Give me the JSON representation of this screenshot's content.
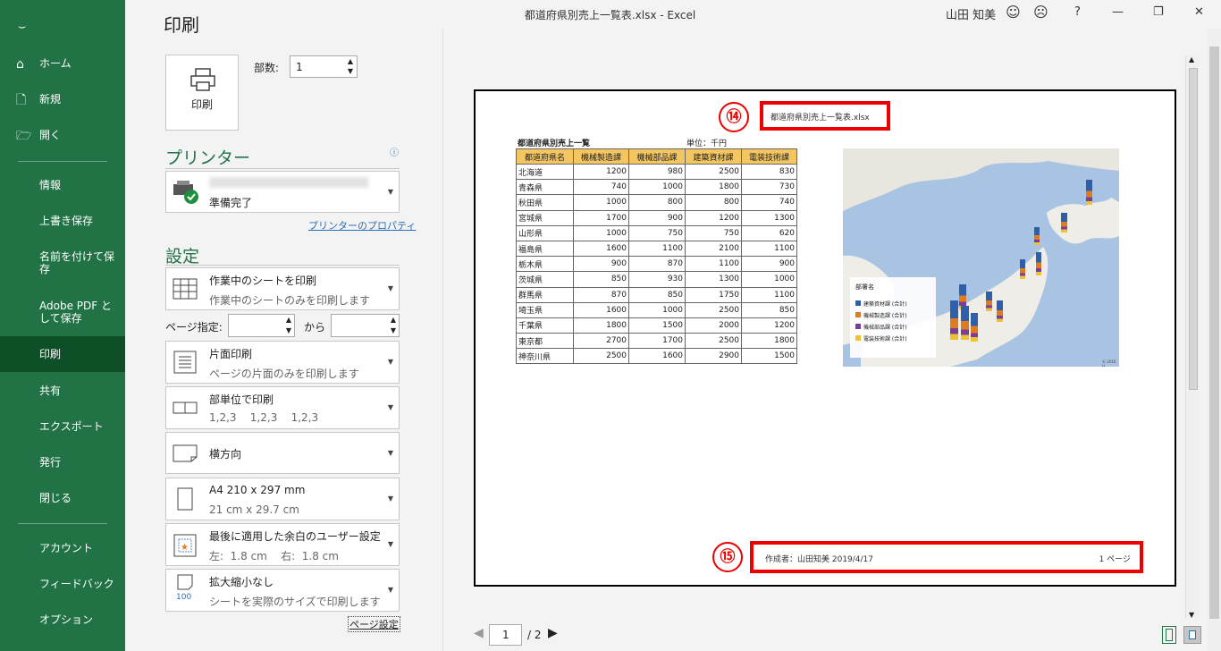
{
  "window": {
    "title": "都道府県別売上一覧表.xlsx  -  Excel",
    "user": "山田 知美",
    "help": "?"
  },
  "sidebar": {
    "items": [
      {
        "label": "ホーム"
      },
      {
        "label": "新規"
      },
      {
        "label": "開く"
      },
      {
        "label": "情報"
      },
      {
        "label": "上書き保存"
      },
      {
        "label": "名前を付けて保存"
      },
      {
        "label": "Adobe PDF として保存"
      },
      {
        "label": "印刷"
      },
      {
        "label": "共有"
      },
      {
        "label": "エクスポート"
      },
      {
        "label": "発行"
      },
      {
        "label": "閉じる"
      },
      {
        "label": "アカウント"
      },
      {
        "label": "フィードバック"
      },
      {
        "label": "オプション"
      }
    ]
  },
  "print": {
    "heading": "印刷",
    "print_button": "印刷",
    "copies_label": "部数:",
    "copies_value": "1",
    "printer_heading": "プリンター",
    "printer_status": "準備完了",
    "printer_properties": "プリンターのプロパティ",
    "settings_heading": "設定",
    "pages_label": "ページ指定:",
    "pages_to": "から",
    "page_setup": "ページ設定",
    "options": [
      {
        "main": "作業中のシートを印刷",
        "sub": "作業中のシートのみを印刷します"
      },
      {
        "main": "片面印刷",
        "sub": "ページの片面のみを印刷します"
      },
      {
        "main": "部単位で印刷",
        "sub": "1,2,3    1,2,3    1,2,3"
      },
      {
        "main": "横方向",
        "sub": ""
      },
      {
        "main": "A4 210 x 297 mm",
        "sub": "21 cm x 29.7 cm"
      },
      {
        "main": "最後に適用した余白のユーザー設定",
        "sub": "左:  1.8 cm    右:  1.8 cm"
      },
      {
        "main": "拡大縮小なし",
        "sub": "シートを実際のサイズで印刷します"
      }
    ],
    "scale_icon_text": "100"
  },
  "preview": {
    "header_text": "都道府県別売上一覧表.xlsx",
    "marker_14": "⑭",
    "marker_15": "⑮",
    "footer_left": "作成者：山田知美 2019/4/17",
    "footer_right": "1 ページ",
    "page_current": "1",
    "page_total": "/ 2",
    "sheet_title": "都道府県別売上一覧",
    "unit": "単位：千円",
    "table": {
      "headers": [
        "都道府県名",
        "機械製造課",
        "機械部品課",
        "建築資材課",
        "電装技術課"
      ],
      "rows": [
        [
          "北海道",
          "1200",
          "980",
          "2500",
          "830"
        ],
        [
          "青森県",
          "740",
          "1000",
          "1800",
          "730"
        ],
        [
          "秋田県",
          "1000",
          "800",
          "800",
          "740"
        ],
        [
          "宮城県",
          "1700",
          "900",
          "1200",
          "1300"
        ],
        [
          "山形県",
          "1000",
          "750",
          "750",
          "620"
        ],
        [
          "福島県",
          "1600",
          "1100",
          "2100",
          "1100"
        ],
        [
          "栃木県",
          "900",
          "870",
          "1100",
          "900"
        ],
        [
          "茨城県",
          "850",
          "930",
          "1300",
          "1000"
        ],
        [
          "群馬県",
          "870",
          "850",
          "1750",
          "1100"
        ],
        [
          "埼玉県",
          "1600",
          "1000",
          "2500",
          "850"
        ],
        [
          "千葉県",
          "1800",
          "1500",
          "2000",
          "1200"
        ],
        [
          "東京都",
          "2700",
          "1700",
          "2500",
          "1800"
        ],
        [
          "神奈川県",
          "2500",
          "1600",
          "2900",
          "1500"
        ]
      ]
    },
    "legend": {
      "title": "部署名",
      "items": [
        {
          "name": "建築資材課 (合計)",
          "color": "#2e5fa8"
        },
        {
          "name": "機械製造課 (合計)",
          "color": "#e07b1f"
        },
        {
          "name": "機械部品課 (合計)",
          "color": "#7a3d98"
        },
        {
          "name": "電装技術課 (合計)",
          "color": "#f2c12e"
        }
      ],
      "copyright": "© 2016 H"
    }
  }
}
